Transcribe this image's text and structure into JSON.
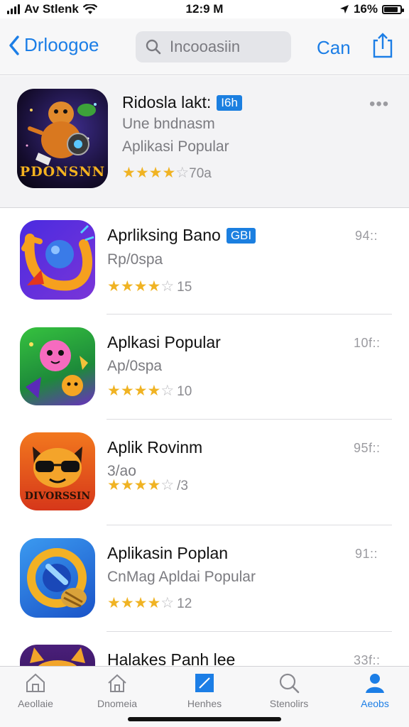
{
  "status": {
    "carrier": "Av Stlenk",
    "time": "12:9 M",
    "battery": "16%",
    "battery_level": 0.85
  },
  "nav": {
    "back_label": "Drloogoe",
    "search_placeholder": "Incooasiin",
    "cancel_label": "Can"
  },
  "featured": {
    "title": "Ridosla lakt:",
    "badge": "I6h",
    "subtitle1": "Une bndnasm",
    "subtitle2": "Aplikasi Popular",
    "rating_text": "70a",
    "stars": 4,
    "icon_text": "PDONSNN",
    "more": "•••"
  },
  "apps": [
    {
      "title": "Aprliksing Bano",
      "badge": "GBI",
      "subtitle": "Rp/0spa",
      "rating_count": "15",
      "stars": 4.5,
      "meta": "94::",
      "icon": "orbit-icon"
    },
    {
      "title": "Aplkasi Popular",
      "badge": "",
      "subtitle": "Ap/0spa",
      "rating_count": "10",
      "stars": 4,
      "meta": "10f::",
      "icon": "creature-icon"
    },
    {
      "title": "Aplik Rovinm",
      "badge": "",
      "subtitle": "3/ao",
      "rating_count": "/3",
      "stars": 4,
      "meta": "95f::",
      "icon": "cat-sunglasses-icon",
      "icon_text": "DIVORSSIN"
    },
    {
      "title": "Aplikasin Poplan",
      "badge": "",
      "subtitle": "CnMag Apldai Popular",
      "rating_count": "12",
      "stars": 4,
      "meta": "91::",
      "icon": "ring-hand-icon"
    },
    {
      "title": "Halakes Panh lee",
      "badge": "",
      "subtitle": "",
      "rating_count": "",
      "stars": 0,
      "meta": "33f::",
      "icon": "purple-cat-icon"
    }
  ],
  "tabs": [
    {
      "label": "Aeollaie",
      "icon": "home-icon",
      "active": false
    },
    {
      "label": "Dnomeia",
      "icon": "home-outline-icon",
      "active": false
    },
    {
      "label": "Henhes",
      "icon": "pencil-square-icon",
      "active": false
    },
    {
      "label": "Stenolirs",
      "icon": "search-icon",
      "active": false
    },
    {
      "label": "Aeobs",
      "icon": "person-icon",
      "active": true
    }
  ],
  "colors": {
    "accent": "#1c7ee6",
    "star": "#f0b323"
  }
}
